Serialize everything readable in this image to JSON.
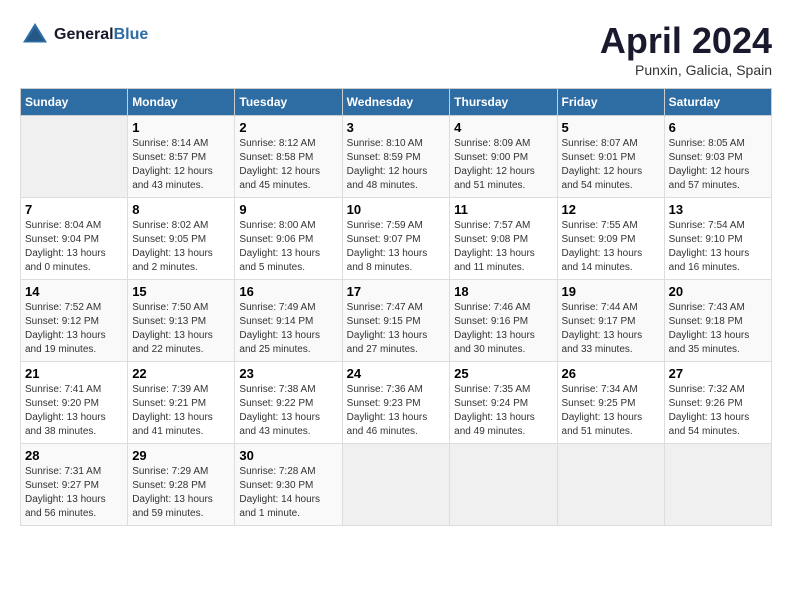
{
  "header": {
    "logo_line1": "General",
    "logo_line2": "Blue",
    "month_title": "April 2024",
    "location": "Punxin, Galicia, Spain"
  },
  "days_of_week": [
    "Sunday",
    "Monday",
    "Tuesday",
    "Wednesday",
    "Thursday",
    "Friday",
    "Saturday"
  ],
  "weeks": [
    [
      {
        "day": "",
        "sunrise": "",
        "sunset": "",
        "daylight": "",
        "empty": true
      },
      {
        "day": "1",
        "sunrise": "Sunrise: 8:14 AM",
        "sunset": "Sunset: 8:57 PM",
        "daylight": "Daylight: 12 hours and 43 minutes."
      },
      {
        "day": "2",
        "sunrise": "Sunrise: 8:12 AM",
        "sunset": "Sunset: 8:58 PM",
        "daylight": "Daylight: 12 hours and 45 minutes."
      },
      {
        "day": "3",
        "sunrise": "Sunrise: 8:10 AM",
        "sunset": "Sunset: 8:59 PM",
        "daylight": "Daylight: 12 hours and 48 minutes."
      },
      {
        "day": "4",
        "sunrise": "Sunrise: 8:09 AM",
        "sunset": "Sunset: 9:00 PM",
        "daylight": "Daylight: 12 hours and 51 minutes."
      },
      {
        "day": "5",
        "sunrise": "Sunrise: 8:07 AM",
        "sunset": "Sunset: 9:01 PM",
        "daylight": "Daylight: 12 hours and 54 minutes."
      },
      {
        "day": "6",
        "sunrise": "Sunrise: 8:05 AM",
        "sunset": "Sunset: 9:03 PM",
        "daylight": "Daylight: 12 hours and 57 minutes."
      }
    ],
    [
      {
        "day": "7",
        "sunrise": "Sunrise: 8:04 AM",
        "sunset": "Sunset: 9:04 PM",
        "daylight": "Daylight: 13 hours and 0 minutes."
      },
      {
        "day": "8",
        "sunrise": "Sunrise: 8:02 AM",
        "sunset": "Sunset: 9:05 PM",
        "daylight": "Daylight: 13 hours and 2 minutes."
      },
      {
        "day": "9",
        "sunrise": "Sunrise: 8:00 AM",
        "sunset": "Sunset: 9:06 PM",
        "daylight": "Daylight: 13 hours and 5 minutes."
      },
      {
        "day": "10",
        "sunrise": "Sunrise: 7:59 AM",
        "sunset": "Sunset: 9:07 PM",
        "daylight": "Daylight: 13 hours and 8 minutes."
      },
      {
        "day": "11",
        "sunrise": "Sunrise: 7:57 AM",
        "sunset": "Sunset: 9:08 PM",
        "daylight": "Daylight: 13 hours and 11 minutes."
      },
      {
        "day": "12",
        "sunrise": "Sunrise: 7:55 AM",
        "sunset": "Sunset: 9:09 PM",
        "daylight": "Daylight: 13 hours and 14 minutes."
      },
      {
        "day": "13",
        "sunrise": "Sunrise: 7:54 AM",
        "sunset": "Sunset: 9:10 PM",
        "daylight": "Daylight: 13 hours and 16 minutes."
      }
    ],
    [
      {
        "day": "14",
        "sunrise": "Sunrise: 7:52 AM",
        "sunset": "Sunset: 9:12 PM",
        "daylight": "Daylight: 13 hours and 19 minutes."
      },
      {
        "day": "15",
        "sunrise": "Sunrise: 7:50 AM",
        "sunset": "Sunset: 9:13 PM",
        "daylight": "Daylight: 13 hours and 22 minutes."
      },
      {
        "day": "16",
        "sunrise": "Sunrise: 7:49 AM",
        "sunset": "Sunset: 9:14 PM",
        "daylight": "Daylight: 13 hours and 25 minutes."
      },
      {
        "day": "17",
        "sunrise": "Sunrise: 7:47 AM",
        "sunset": "Sunset: 9:15 PM",
        "daylight": "Daylight: 13 hours and 27 minutes."
      },
      {
        "day": "18",
        "sunrise": "Sunrise: 7:46 AM",
        "sunset": "Sunset: 9:16 PM",
        "daylight": "Daylight: 13 hours and 30 minutes."
      },
      {
        "day": "19",
        "sunrise": "Sunrise: 7:44 AM",
        "sunset": "Sunset: 9:17 PM",
        "daylight": "Daylight: 13 hours and 33 minutes."
      },
      {
        "day": "20",
        "sunrise": "Sunrise: 7:43 AM",
        "sunset": "Sunset: 9:18 PM",
        "daylight": "Daylight: 13 hours and 35 minutes."
      }
    ],
    [
      {
        "day": "21",
        "sunrise": "Sunrise: 7:41 AM",
        "sunset": "Sunset: 9:20 PM",
        "daylight": "Daylight: 13 hours and 38 minutes."
      },
      {
        "day": "22",
        "sunrise": "Sunrise: 7:39 AM",
        "sunset": "Sunset: 9:21 PM",
        "daylight": "Daylight: 13 hours and 41 minutes."
      },
      {
        "day": "23",
        "sunrise": "Sunrise: 7:38 AM",
        "sunset": "Sunset: 9:22 PM",
        "daylight": "Daylight: 13 hours and 43 minutes."
      },
      {
        "day": "24",
        "sunrise": "Sunrise: 7:36 AM",
        "sunset": "Sunset: 9:23 PM",
        "daylight": "Daylight: 13 hours and 46 minutes."
      },
      {
        "day": "25",
        "sunrise": "Sunrise: 7:35 AM",
        "sunset": "Sunset: 9:24 PM",
        "daylight": "Daylight: 13 hours and 49 minutes."
      },
      {
        "day": "26",
        "sunrise": "Sunrise: 7:34 AM",
        "sunset": "Sunset: 9:25 PM",
        "daylight": "Daylight: 13 hours and 51 minutes."
      },
      {
        "day": "27",
        "sunrise": "Sunrise: 7:32 AM",
        "sunset": "Sunset: 9:26 PM",
        "daylight": "Daylight: 13 hours and 54 minutes."
      }
    ],
    [
      {
        "day": "28",
        "sunrise": "Sunrise: 7:31 AM",
        "sunset": "Sunset: 9:27 PM",
        "daylight": "Daylight: 13 hours and 56 minutes."
      },
      {
        "day": "29",
        "sunrise": "Sunrise: 7:29 AM",
        "sunset": "Sunset: 9:28 PM",
        "daylight": "Daylight: 13 hours and 59 minutes."
      },
      {
        "day": "30",
        "sunrise": "Sunrise: 7:28 AM",
        "sunset": "Sunset: 9:30 PM",
        "daylight": "Daylight: 14 hours and 1 minute."
      },
      {
        "day": "",
        "sunrise": "",
        "sunset": "",
        "daylight": "",
        "empty": true
      },
      {
        "day": "",
        "sunrise": "",
        "sunset": "",
        "daylight": "",
        "empty": true
      },
      {
        "day": "",
        "sunrise": "",
        "sunset": "",
        "daylight": "",
        "empty": true
      },
      {
        "day": "",
        "sunrise": "",
        "sunset": "",
        "daylight": "",
        "empty": true
      }
    ]
  ]
}
